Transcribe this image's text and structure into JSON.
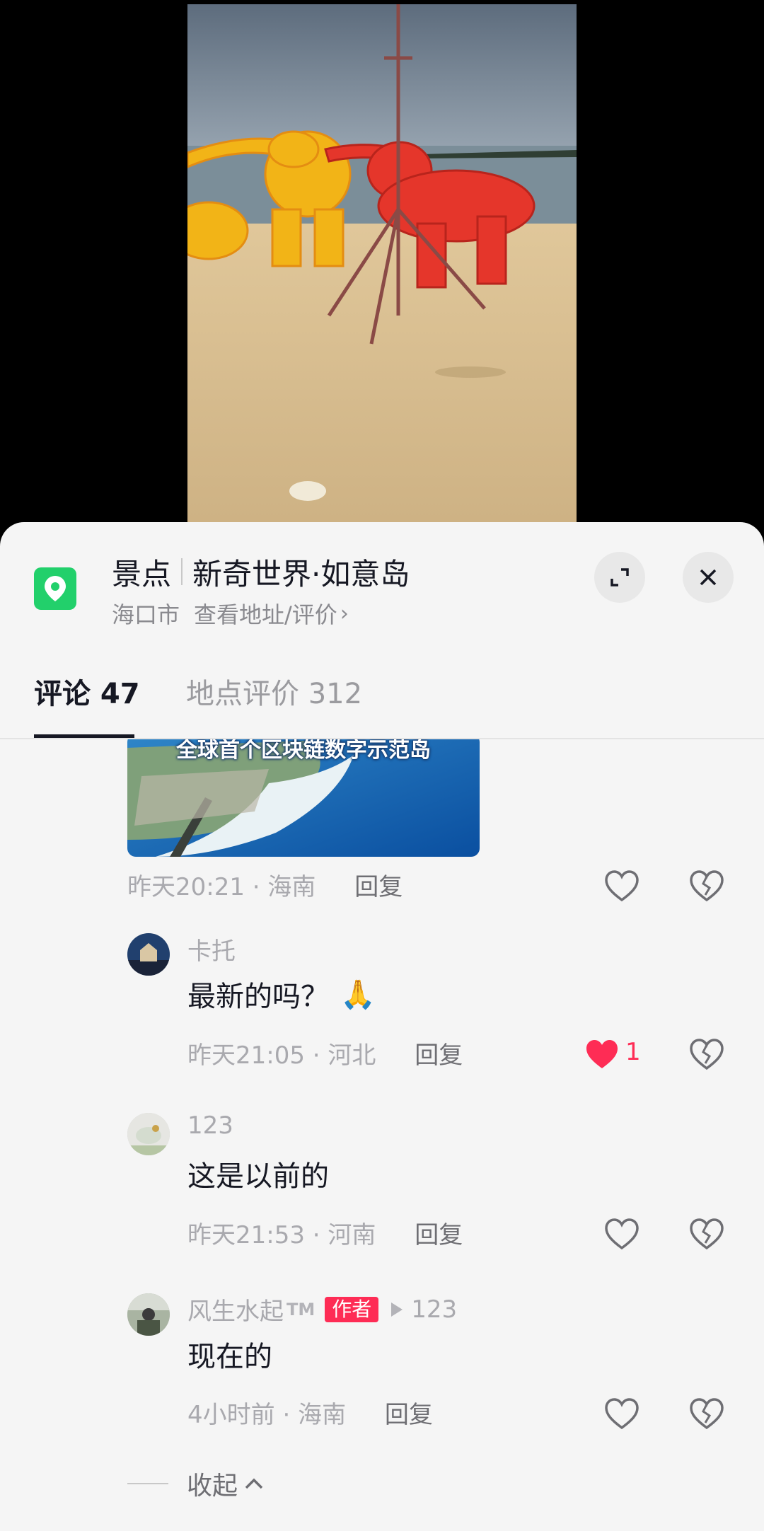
{
  "poi": {
    "category": "景点",
    "name": "新奇世界·如意岛",
    "city": "海口市",
    "link": "查看地址/评价",
    "expand_icon": "expand-icon",
    "close_icon": "close-icon",
    "pin_icon": "location-pin-icon"
  },
  "tabs": [
    {
      "label": "评论 47",
      "active": true
    },
    {
      "label": "地点评价 312",
      "active": false
    }
  ],
  "thumbnail_caption": "全球首个区块链数字示范岛",
  "comments": [
    {
      "time": "昨天20:21",
      "sep": "·",
      "region": "海南",
      "reply": "回复"
    },
    {
      "username": "卡托",
      "text": "最新的吗？",
      "emoji": "🙏",
      "time": "昨天21:05",
      "sep": "·",
      "region": "河北",
      "reply": "回复",
      "likes": "1",
      "liked": true
    },
    {
      "username": "123",
      "text": "这是以前的",
      "time": "昨天21:53",
      "sep": "·",
      "region": "河南",
      "reply": "回复"
    },
    {
      "username": "风生水起",
      "tm": "TM",
      "badge": "作者",
      "reply_to": "123",
      "text": "现在的",
      "time": "4小时前",
      "sep": "·",
      "region": "海南",
      "reply": "回复"
    }
  ],
  "collapse_label": "收起",
  "colors": {
    "accent": "#fe2c55",
    "poi_green": "#22d06b",
    "sheet_bg": "#f5f5f5",
    "text_primary": "#161823",
    "text_secondary": "#a9a9ae"
  }
}
